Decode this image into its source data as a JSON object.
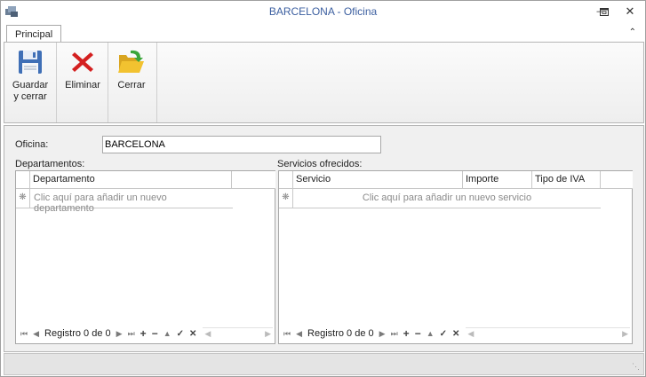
{
  "window": {
    "title": "BARCELONA - Oficina",
    "minimize_icon": "minimize-icon",
    "restore_icon": "restore-icon",
    "close_icon": "close-icon"
  },
  "ribbon": {
    "tab_label": "Principal",
    "buttons": [
      {
        "label_line1": "Guardar",
        "label_line2": "y cerrar",
        "icon": "floppy-disk-icon"
      },
      {
        "label_line1": "Eliminar",
        "label_line2": "",
        "icon": "red-x-icon"
      },
      {
        "label_line1": "Cerrar",
        "label_line2": "",
        "icon": "folder-open-icon"
      }
    ]
  },
  "form": {
    "oficina_label": "Oficina:",
    "oficina_value": "BARCELONA",
    "departamentos_label": "Departamentos:",
    "servicios_label": "Servicios ofrecidos:"
  },
  "departamentos_grid": {
    "columns": [
      "Departamento"
    ],
    "new_row_text": "Clic aquí para añadir un nuevo departamento",
    "nav_text": "Registro 0 de 0"
  },
  "servicios_grid": {
    "columns": [
      "Servicio",
      "Importe",
      "Tipo de IVA"
    ],
    "new_row_text": "Clic aquí para añadir un nuevo servicio",
    "nav_text": "Registro 0 de 0"
  },
  "colors": {
    "title_text": "#3c5fa0",
    "delete_red": "#d42020",
    "folder_yellow": "#f2c230",
    "arrow_green": "#3aa63a"
  }
}
